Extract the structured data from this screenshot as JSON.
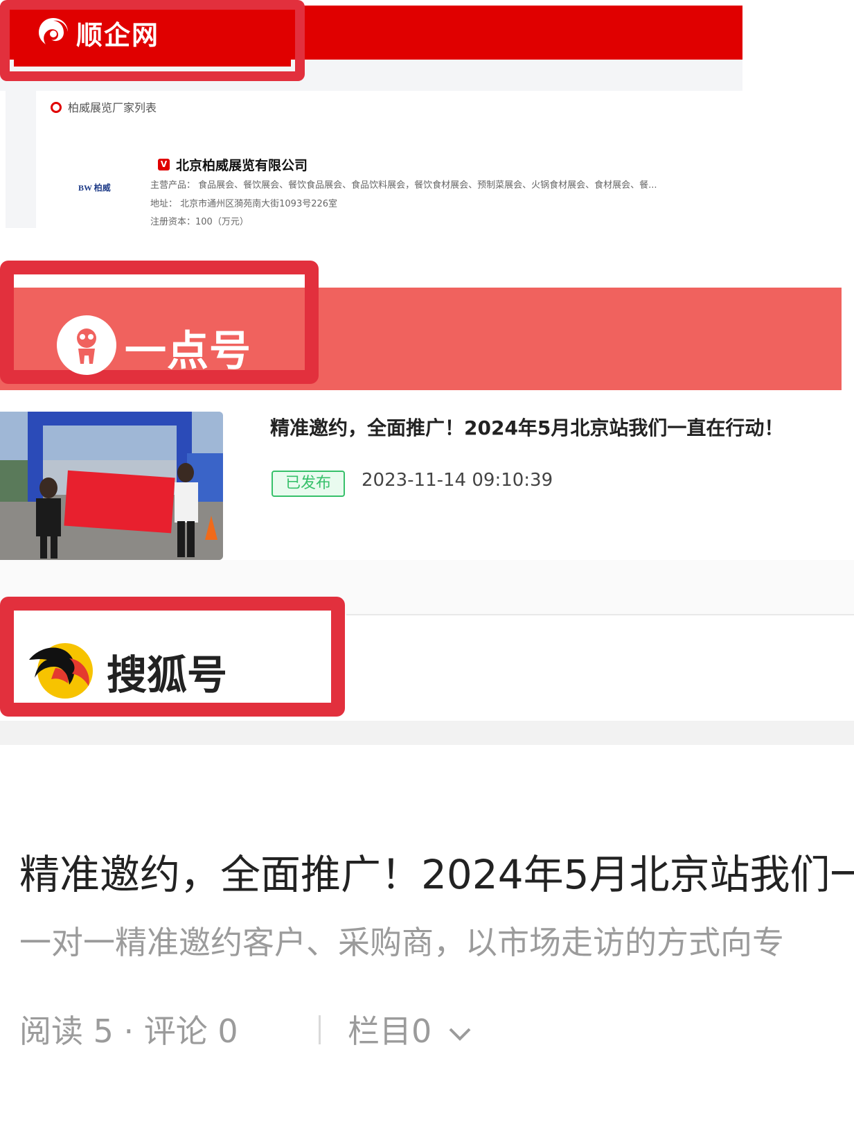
{
  "shunqi": {
    "brand": "顺企网",
    "breadcrumb": "柏威展览厂家列表",
    "thumb_logo": "BW 柏威",
    "badge": "V",
    "company": "北京柏威展览有限公司",
    "products": "主营产品：  食品展会、餐饮展会、餐饮食品展会、食品饮料展会，餐饮食材展会、预制菜展会、火锅食材展会、食材展会、餐...",
    "address": "地址：  北京市通州区漪苑南大街1093号226室",
    "capital": "注册资本：100（万元）"
  },
  "yidian": {
    "brand": "一点号",
    "article_title": "精准邀约，全面推广！2024年5月北京站我们一直在行动！",
    "status": "已发布",
    "timestamp": "2023-11-14 09:10:39"
  },
  "sohu": {
    "brand": "搜狐号",
    "article_title": "精准邀约，全面推广！2024年5月北京站我们一",
    "subtitle": "一对一精准邀约客户、采购商，以市场走访的方式向专",
    "reads": "阅读 5 · 评论 0",
    "column": "栏目0"
  },
  "colors": {
    "shunqi_red": "#e00000",
    "yidian_red": "#f0625e",
    "frame_red": "#e2303d",
    "status_green": "#36c06a"
  }
}
